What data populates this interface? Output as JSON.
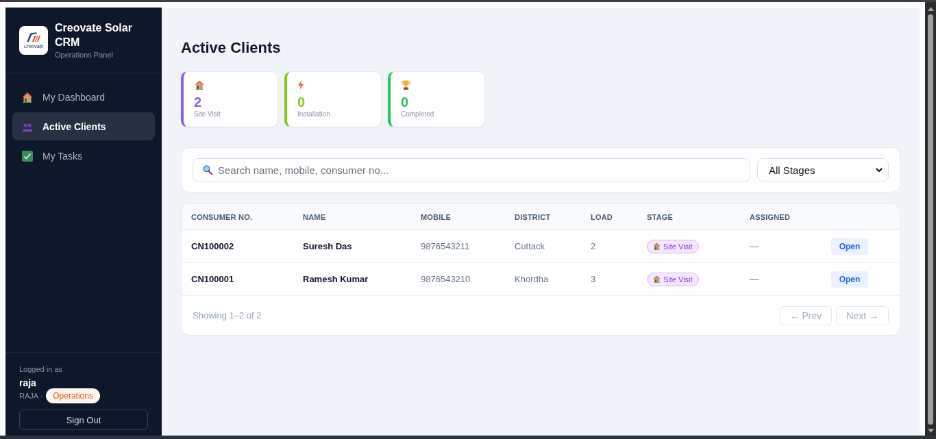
{
  "sidebar": {
    "logo": {
      "text": "Creovate"
    },
    "title": "Creovate Solar CRM",
    "subtitle": "Operations Panel",
    "nav": [
      {
        "label": "My Dashboard",
        "selected": false
      },
      {
        "label": "Active Clients",
        "selected": true
      },
      {
        "label": "My Tasks",
        "selected": false
      }
    ],
    "user": {
      "caption": "Logged in as",
      "name": "raja",
      "username": "RAJA ·",
      "role": "Operations"
    },
    "sign_out": "Sign Out"
  },
  "page": {
    "title": "Active Clients"
  },
  "stats": [
    {
      "value": "2",
      "label": "Site Visit",
      "color": "#8b5cf6"
    },
    {
      "value": "0",
      "label": "Installation",
      "color": "#84cc16"
    },
    {
      "value": "0",
      "label": "Completed",
      "color": "#22c55e"
    }
  ],
  "filters": {
    "search": {
      "placeholder": "Search name, mobile, consumer no..."
    },
    "stage_select": {
      "value": "All Stages"
    }
  },
  "table": {
    "columns": [
      "CONSUMER NO.",
      "NAME",
      "MOBILE",
      "DISTRICT",
      "LOAD",
      "STAGE",
      "ASSIGNED"
    ],
    "rows": [
      {
        "consumer_no": "CN100002",
        "name": "Suresh Das",
        "mobile": "9876543211",
        "district": "Cuttack",
        "load": "2",
        "stage": "Site Visit",
        "assigned": "—",
        "action": "Open"
      },
      {
        "consumer_no": "CN100001",
        "name": "Ramesh Kumar",
        "mobile": "9876543210",
        "district": "Khordha",
        "load": "3",
        "stage": "Site Visit",
        "assigned": "—",
        "action": "Open"
      }
    ]
  },
  "pagination": {
    "summary": "Showing 1–2 of 2",
    "prev": {
      "label": "← Prev",
      "disabled": true
    },
    "next": {
      "label": "Next →",
      "disabled": true
    }
  }
}
